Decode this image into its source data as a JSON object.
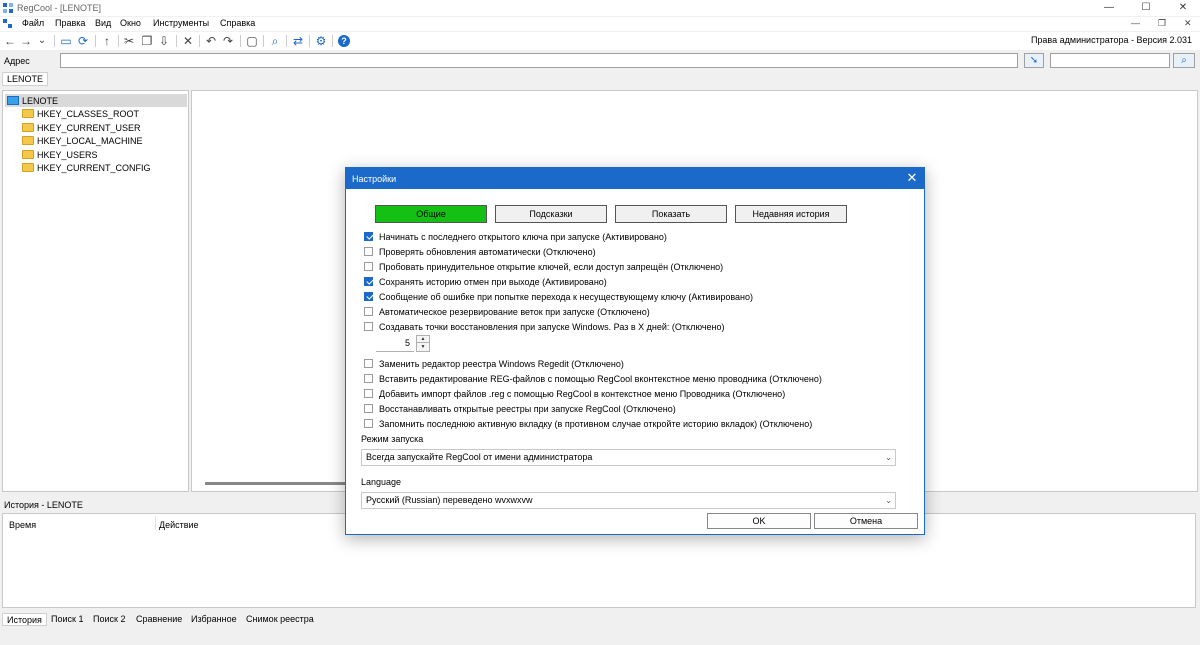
{
  "window": {
    "title": "RegCool - [LENOTE]",
    "controls": {
      "minimize": "—",
      "maximize": "☐",
      "close": "✕"
    },
    "mdi_controls": {
      "minimize": "—",
      "restore": "❐",
      "close": "✕"
    }
  },
  "menu": [
    "Файл",
    "Правка",
    "Вид",
    "Окно",
    "Инструменты",
    "Справка"
  ],
  "toolbar": {
    "icons": [
      "back-arrow",
      "forward-arrow",
      "dropdown-chevron",
      "computer",
      "refresh-network",
      "up-arrow",
      "cut",
      "copy",
      "export",
      "delete",
      "undo",
      "redo",
      "new-key",
      "find",
      "refresh",
      "settings",
      "help"
    ],
    "status": "Права администратора - Версия 2.031"
  },
  "address": {
    "label": "Адрес",
    "value": "",
    "search_value": ""
  },
  "doc_tab": "LENOTE",
  "tree": {
    "root": "LENOTE",
    "hives": [
      "HKEY_CLASSES_ROOT",
      "HKEY_CURRENT_USER",
      "HKEY_LOCAL_MACHINE",
      "HKEY_USERS",
      "HKEY_CURRENT_CONFIG"
    ]
  },
  "history": {
    "title": "История - LENOTE",
    "columns": [
      "Время",
      "Действие"
    ]
  },
  "bottom_tabs": [
    "История",
    "Поиск 1",
    "Поиск 2",
    "Сравнение",
    "Избранное",
    "Снимок реестра"
  ],
  "dialog": {
    "title": "Настройки",
    "close": "✕",
    "tabs": [
      "Общие",
      "Подсказки",
      "Показать",
      "Недавняя история"
    ],
    "active_tab": 0,
    "active_tab_color": "#14c014",
    "options_a": [
      {
        "label": "Начинать с последнего открытого ключа при запуске (Активировано)",
        "checked": true
      },
      {
        "label": "Проверять обновления автоматически (Отключено)",
        "checked": false
      },
      {
        "label": "Пробовать принудительное открытие ключей, если доступ запрещён (Отключено)",
        "checked": false
      },
      {
        "label": "Сохранять историю отмен при выходе (Активировано)",
        "checked": true
      },
      {
        "label": "Сообщение об ошибке при попытке перехода к несуществующему ключу (Активировано)",
        "checked": true
      },
      {
        "label": "Автоматическое резервирование веток при запуске (Отключено)",
        "checked": false
      },
      {
        "label": "Создавать точки восстановления при запуске Windows. Раз в X дней: (Отключено)",
        "checked": false
      }
    ],
    "restore_days": "5",
    "options_b": [
      {
        "label": "Заменить редактор реестра Windows Regedit (Отключено)",
        "checked": false
      },
      {
        "label": "Вставить редактирование REG-файлов с помощью RegCool вконтекстное меню проводника (Отключено)",
        "checked": false
      },
      {
        "label": "Добавить импорт файлов .reg с помощью RegCool в контекстное меню Проводника (Отключено)",
        "checked": false
      },
      {
        "label": "Восстанавливать открытые реестры при запуске RegCool (Отключено)",
        "checked": false
      },
      {
        "label": "Запомнить последнюю активную вкладку (в противном случае откройте историю вкладок) (Отключено)",
        "checked": false
      }
    ],
    "launch_mode_label": "Режим запуска",
    "launch_mode_value": "Всегда запускайте RegCool от имени администратора",
    "language_label": "Language",
    "language_value": "Русский (Russian) переведено wvxwxvw",
    "ok": "OK",
    "cancel": "Отмена"
  }
}
